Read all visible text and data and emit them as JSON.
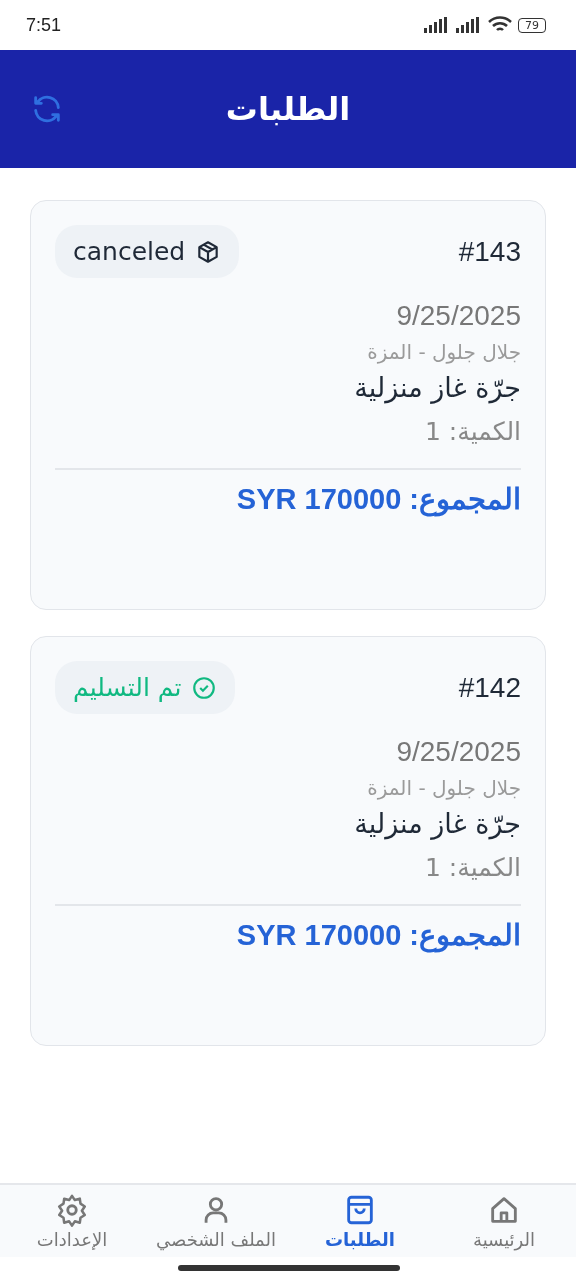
{
  "status_bar": {
    "time": "7:51",
    "battery": "79"
  },
  "header": {
    "title": "الطلبات"
  },
  "orders": [
    {
      "number": "#143",
      "status": {
        "kind": "canceled",
        "label": "canceled"
      },
      "date": "9/25/2025",
      "customer": "جلال جلول - المزة",
      "product": "جرّة غاز منزلية",
      "quantity": "الكمية: 1",
      "total": "المجموع: SYR 170000"
    },
    {
      "number": "#142",
      "status": {
        "kind": "delivered",
        "label": "تم التسليم"
      },
      "date": "9/25/2025",
      "customer": "جلال جلول - المزة",
      "product": "جرّة غاز منزلية",
      "quantity": "الكمية: 1",
      "total": "المجموع: SYR 170000"
    }
  ],
  "nav": [
    {
      "kind": "home",
      "label": "الرئيسية",
      "selected": false
    },
    {
      "kind": "orders",
      "label": "الطلبات",
      "selected": true
    },
    {
      "kind": "profile",
      "label": "الملف الشخصي",
      "selected": false
    },
    {
      "kind": "settings",
      "label": "الإعدادات",
      "selected": false
    }
  ]
}
